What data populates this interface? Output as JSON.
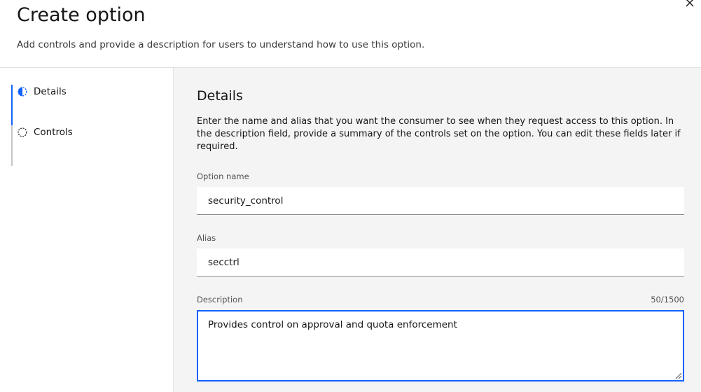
{
  "header": {
    "title": "Create option",
    "subtitle": "Add controls and provide a description for users to understand how to use this option.",
    "close_icon": "close-icon"
  },
  "sidebar": {
    "steps": [
      {
        "label": "Details",
        "state": "current",
        "icon": "half-circle-icon"
      },
      {
        "label": "Controls",
        "state": "incomplete",
        "icon": "dashed-circle-icon"
      }
    ]
  },
  "main": {
    "section_title": "Details",
    "section_description": "Enter the name and alias that you want the consumer to see when they request access to this option. In the description field, provide a summary of the controls set on the option. You can edit these fields later if required.",
    "fields": {
      "option_name": {
        "label": "Option name",
        "value": "security_control"
      },
      "alias": {
        "label": "Alias",
        "value": "secctrl"
      },
      "description": {
        "label": "Description",
        "value": "Provides control on approval and quota enforcement",
        "counter": "50/1500"
      }
    }
  },
  "colors": {
    "accent": "#0f62fe",
    "panel_bg": "#f4f4f4",
    "text_primary": "#161616",
    "text_secondary": "#525252"
  }
}
